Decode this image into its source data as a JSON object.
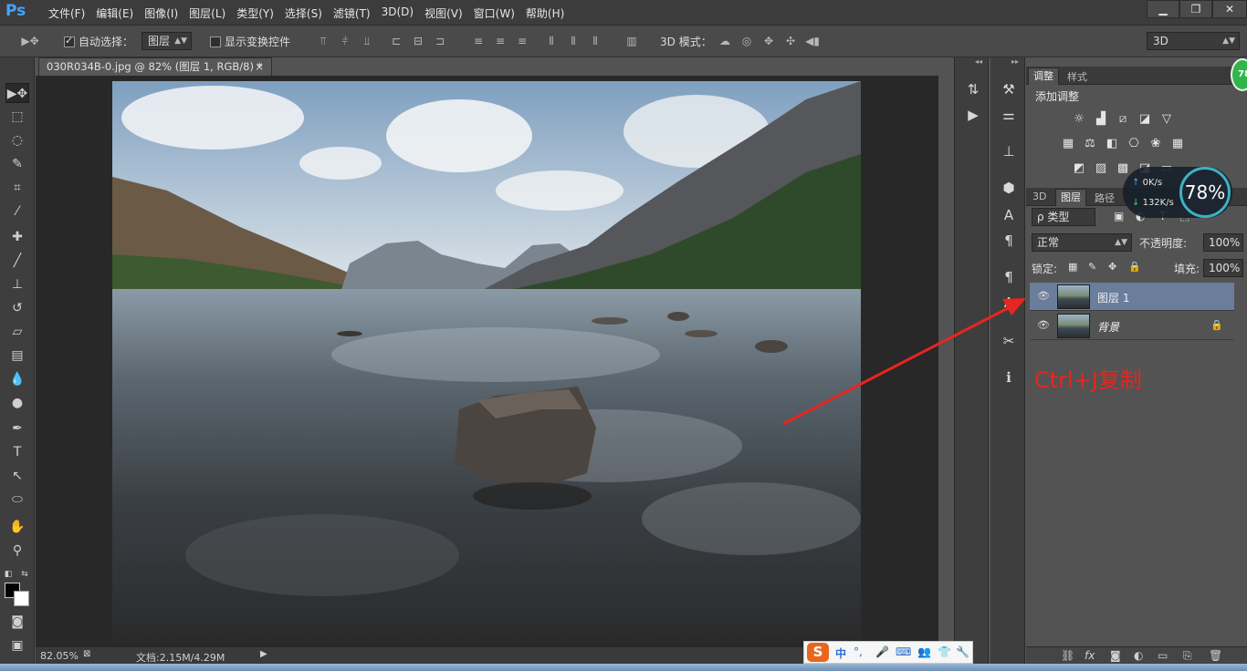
{
  "app": {
    "logo": "Ps",
    "menu": [
      "文件(F)",
      "编辑(E)",
      "图像(I)",
      "图层(L)",
      "类型(Y)",
      "选择(S)",
      "滤镜(T)",
      "3D(D)",
      "视图(V)",
      "窗口(W)",
      "帮助(H)"
    ],
    "window_controls": {
      "minimize": "▁",
      "restore": "❐",
      "close": "✕"
    }
  },
  "options_bar": {
    "auto_select_label": "自动选择：",
    "auto_select_checked": true,
    "auto_select_target": "图层",
    "show_transform_label": "显示变换控件",
    "show_transform_checked": false,
    "mode_3d_label": "3D 模式：",
    "workspace": "3D"
  },
  "document": {
    "tab_title": "030R034B-0.jpg @ 82% (图层 1, RGB/8) *",
    "tab_close": "×",
    "zoom": "82.05%",
    "doc_size": "文档:2.15M/4.29M"
  },
  "panels": {
    "adjustments": {
      "tabs": [
        "调整",
        "样式"
      ],
      "active_tab": "调整",
      "title": "添加调整"
    },
    "layers": {
      "tabs": [
        "3D",
        "图层",
        "路径"
      ],
      "active_tab": "图层",
      "filter_label": "ρ 类型",
      "blend_mode": "正常",
      "opacity_label": "不透明度:",
      "opacity_value": "100%",
      "lock_label": "锁定:",
      "fill_label": "填充:",
      "fill_value": "100%",
      "items": [
        {
          "name": "图层 1",
          "selected": true,
          "locked": false
        },
        {
          "name": "背景",
          "selected": false,
          "locked": true
        }
      ]
    }
  },
  "annotation": {
    "text": "Ctrl+J复制",
    "color": "#e8251f"
  },
  "net_monitor": {
    "upload": "0K/s",
    "download": "132K/s",
    "percent": "78%",
    "percent_num": "78",
    "badge": "78"
  },
  "ime": {
    "logo": "S",
    "mode": "中",
    "punct": "°,"
  }
}
